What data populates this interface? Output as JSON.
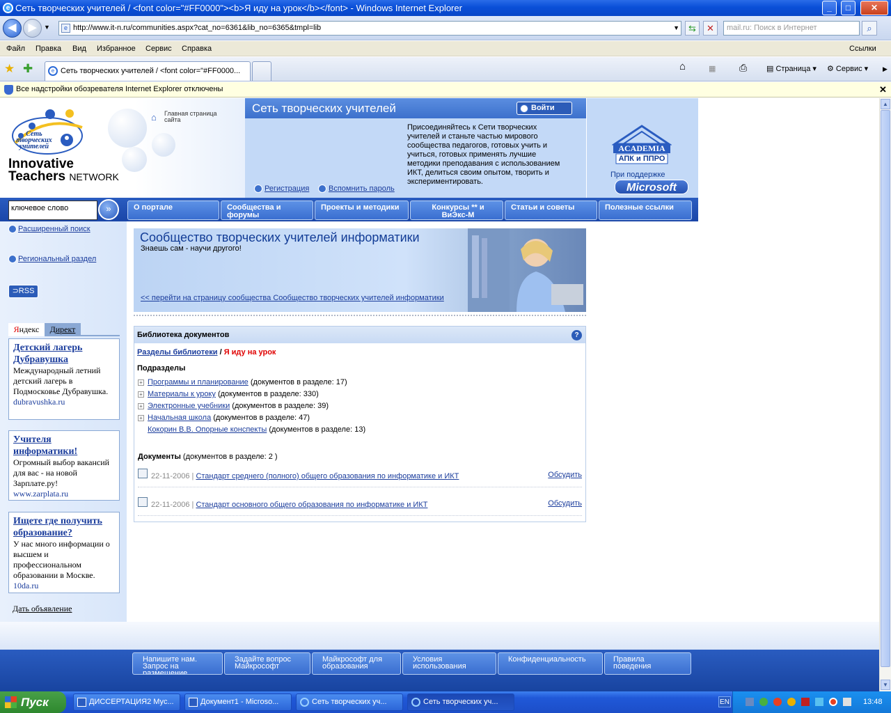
{
  "window": {
    "title": "Сеть творческих учителей / <font color=\"#FF0000\"><b>Я иду на урок</b></font> - Windows Internet Explorer",
    "minimize": "_",
    "maximize": "□",
    "close": "✕"
  },
  "address": {
    "url": "http://www.it-n.ru/communities.aspx?cat_no=6361&lib_no=6365&tmpl=lib",
    "search_placeholder": "mail.ru: Поиск в Интернет"
  },
  "menu": {
    "items": [
      "Файл",
      "Правка",
      "Вид",
      "Избранное",
      "Сервис",
      "Справка"
    ],
    "links": "Ссылки"
  },
  "tabs": {
    "active": "Сеть творческих учителей / <font color=\"#FF0000...",
    "page_menu": "Страница",
    "tools_menu": "Сервис"
  },
  "infobar": {
    "text": "Все надстройки обозревателя Internet Explorer отключены"
  },
  "site": {
    "logo_ru": [
      "Сеть",
      "творческих",
      "учителей"
    ],
    "logo_en1": "Innovative",
    "logo_en2": "Teachers",
    "logo_en3": "NETWORK",
    "home_link": "Главная страница сайта",
    "header_title": "Сеть творческих учителей",
    "login": "Войти",
    "join_text": "Присоединяйтесь к Сети творческих учителей и станьте частью мирового сообщества педагогов, готовых учить и учиться, готовых применять лучшие методики преподавания с использованием ИКТ, делиться своим опытом, творить и экспериментировать.",
    "register": "Регистрация",
    "remind": "Вспомнить пароль",
    "academia": "ACADEMIA",
    "academia_sub": "АПК и ППРО",
    "support": "При поддержке",
    "microsoft": "Microsoft"
  },
  "search": {
    "keyword": "ключевое слово",
    "advanced": "Расширенный поиск",
    "regional": "Региональный раздел",
    "rss": "RSS"
  },
  "nav": [
    {
      "label": "О портале"
    },
    {
      "label": "Сообщества и форумы"
    },
    {
      "label": "Проекты и методики"
    },
    {
      "label": "Конкурсы ** и ВиЭкс-М"
    },
    {
      "label": "Статьи и советы"
    },
    {
      "label": "Полезные ссылки"
    }
  ],
  "ads": {
    "yandex": "Яндекс",
    "direct": "Директ",
    "items": [
      {
        "title": "Детский лагерь Дубравушка",
        "text": "Международный летний детский лагерь в Подмосковье Дубравушка.",
        "url": "dubravushka.ru"
      },
      {
        "title": "Учителя информатики!",
        "text": "Огромный выбор вакансий для вас - на новой Зарплате.ру!",
        "url": "www.zarplata.ru"
      },
      {
        "title": "Ищете где получить образование?",
        "text": "У нас много информации о высшем и профессиональном образовании в Москве.",
        "url": "10da.ru"
      }
    ],
    "post_ad": "Дать объявление"
  },
  "banner": {
    "title": "Сообщество творческих учителей информатики",
    "subtitle": "Знаешь сам - научи другого!",
    "link": "<< перейти на страницу сообщества Сообщество творческих учителей информатики"
  },
  "library": {
    "header": "Библиотека документов",
    "help": "?",
    "crumb_root": "Разделы библиотеки",
    "crumb_sep": "/",
    "crumb_current": "Я иду на урок",
    "subsections_label": "Подразделы",
    "subsections": [
      {
        "name": "Программы и планирование",
        "count": "(документов в разделе: 17)"
      },
      {
        "name": "Материалы к уроку",
        "count": "(документов в разделе: 330)"
      },
      {
        "name": "Электронные учебники",
        "count": "(документов в разделе: 39)"
      },
      {
        "name": "Начальная школа",
        "count": "(документов в разделе: 47)"
      },
      {
        "name": "Кокорин В.В. Опорные конспекты",
        "count": "(документов в разделе: 13)"
      }
    ],
    "documents_label": "Документы",
    "documents_count": "(документов в разделе: 2 )",
    "documents": [
      {
        "date": "22-11-2006",
        "title": "Стандарт среднего (полного) общего образования по информатике и ИКТ",
        "discuss": "Обсудить"
      },
      {
        "date": "22-11-2006",
        "title": "Стандарт основного общего образования по информатике и ИКТ",
        "discuss": "Обсудить"
      }
    ]
  },
  "footer": [
    "Напишите нам. Запрос на размещение рекламы",
    "Задайте вопрос Майкрософт",
    "Майкрософт для образования",
    "Условия использования",
    "Конфиденциальность",
    "Правила поведения"
  ],
  "taskbar": {
    "start": "Пуск",
    "tasks": [
      "ДИССЕРТАЦИЯ2 Мус...",
      "Документ1 - Microso...",
      "Сеть творческих уч...",
      "Сеть творческих уч..."
    ],
    "lang": "EN",
    "time": "13:48"
  }
}
